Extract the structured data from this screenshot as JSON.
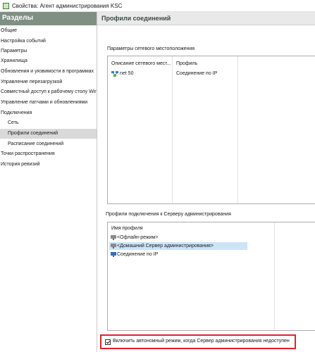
{
  "window": {
    "title": "Свойства: Агент администрирования KSC"
  },
  "sidebar": {
    "header": "Разделы",
    "items": [
      {
        "label": "Общие"
      },
      {
        "label": "Настройка событий"
      },
      {
        "label": "Параметры"
      },
      {
        "label": "Хранилища"
      },
      {
        "label": "Обновления и уязвимости в программах"
      },
      {
        "label": "Управление перезагрузкой"
      },
      {
        "label": "Совместный доступ к рабочему столу Windo"
      },
      {
        "label": "Управление патчами и обновлениями"
      },
      {
        "label": "Подключения"
      },
      {
        "label": "Сеть"
      },
      {
        "label": "Профили соединений"
      },
      {
        "label": "Расписание соединений"
      },
      {
        "label": "Точки распространения"
      },
      {
        "label": "История ревизий"
      }
    ],
    "selected": "Профили соединений"
  },
  "main": {
    "title": "Профили соединений",
    "location_group": {
      "label": "Параметры сетевого местоположения",
      "columns": [
        "Описание сетевого мест...",
        "Профиль"
      ],
      "rows": [
        {
          "description": "net 50",
          "profile": "Соединение по IP",
          "icon": "network-location-icon"
        }
      ]
    },
    "profiles_group": {
      "label": "Профили подключения к Серверу администрирования",
      "column": "Имя профиля",
      "rows": [
        {
          "name": "<Офлайн-режим>",
          "icon": "computer-gray-icon"
        },
        {
          "name": "<Домашний Сервер администрирования>",
          "icon": "computer-gray-icon",
          "selected": true
        },
        {
          "name": "Соединение по IP",
          "icon": "computer-blue-icon"
        }
      ]
    },
    "offline_checkbox": {
      "label": "Включить автономный режим, когда Сервер администрирования недоступен",
      "checked": true
    }
  },
  "colors": {
    "sidebar_header": "#7f8f84",
    "selection": "#cce4f7",
    "nav_selected": "#d9d9d9",
    "highlight_box": "#e0222b"
  }
}
